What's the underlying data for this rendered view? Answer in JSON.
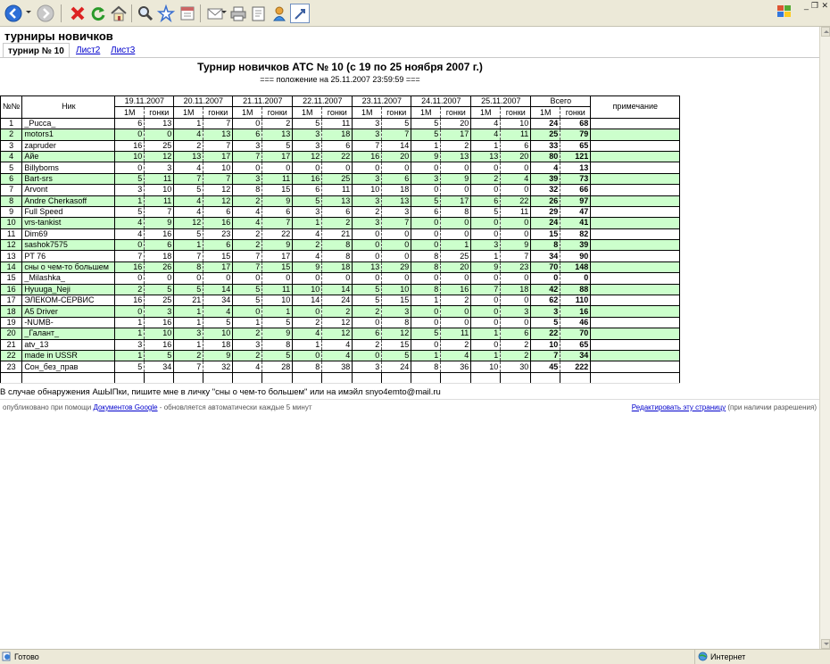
{
  "page": {
    "title": "турниры новичков"
  },
  "tabs": [
    {
      "label": "турнир № 10",
      "active": true
    },
    {
      "label": "Лист2",
      "active": false
    },
    {
      "label": "Лист3",
      "active": false
    }
  ],
  "sheet": {
    "title": "Турнир новичков АТС № 10 (с 19 по 25 ноября 2007 г.)",
    "subtitle": "=== положение на 25.11.2007 23:59:59 ===",
    "headers": {
      "num": "№№",
      "nick": "Ник",
      "dates": [
        "19.11.2007",
        "20.11.2007",
        "21.11.2007",
        "22.11.2007",
        "23.11.2007",
        "24.11.2007",
        "25.11.2007"
      ],
      "total": "Всего",
      "note": "примечание",
      "sub1": "1М",
      "sub2": "гонки"
    },
    "rows": [
      {
        "n": "1",
        "nick": "_Рucca_",
        "v": [
          6,
          13,
          1,
          7,
          0,
          2,
          5,
          11,
          3,
          5,
          5,
          20,
          4,
          10
        ],
        "t1": "24",
        "t2": "68"
      },
      {
        "n": "2",
        "nick": "motors1",
        "v": [
          0,
          0,
          4,
          13,
          6,
          13,
          3,
          18,
          3,
          7,
          5,
          17,
          4,
          11
        ],
        "t1": "25",
        "t2": "79"
      },
      {
        "n": "3",
        "nick": "zapruder",
        "v": [
          16,
          25,
          2,
          7,
          3,
          5,
          3,
          6,
          7,
          14,
          1,
          2,
          1,
          6
        ],
        "t1": "33",
        "t2": "65"
      },
      {
        "n": "4",
        "nick": "Айе",
        "v": [
          10,
          12,
          13,
          17,
          7,
          17,
          12,
          22,
          16,
          20,
          9,
          13,
          13,
          20
        ],
        "t1": "80",
        "t2": "121"
      },
      {
        "n": "5",
        "nick": "Billyboms",
        "v": [
          0,
          3,
          4,
          10,
          0,
          0,
          0,
          0,
          0,
          0,
          0,
          0,
          0,
          0
        ],
        "t1": "4",
        "t2": "13"
      },
      {
        "n": "6",
        "nick": "Bart-srs",
        "v": [
          5,
          11,
          7,
          7,
          3,
          11,
          16,
          25,
          3,
          6,
          3,
          9,
          2,
          4
        ],
        "t1": "39",
        "t2": "73"
      },
      {
        "n": "7",
        "nick": "Arvont",
        "v": [
          3,
          10,
          5,
          12,
          8,
          15,
          6,
          11,
          10,
          18,
          0,
          0,
          0,
          0
        ],
        "t1": "32",
        "t2": "66"
      },
      {
        "n": "8",
        "nick": "Andre Cherkasoff",
        "v": [
          1,
          11,
          4,
          12,
          2,
          9,
          5,
          13,
          3,
          13,
          5,
          17,
          6,
          22
        ],
        "t1": "26",
        "t2": "97"
      },
      {
        "n": "9",
        "nick": "Full Speed",
        "v": [
          5,
          7,
          4,
          6,
          4,
          6,
          3,
          6,
          2,
          3,
          6,
          8,
          5,
          11
        ],
        "t1": "29",
        "t2": "47"
      },
      {
        "n": "10",
        "nick": "vrs-tankist",
        "v": [
          4,
          9,
          12,
          16,
          4,
          7,
          1,
          2,
          3,
          7,
          0,
          0,
          0,
          0
        ],
        "t1": "24",
        "t2": "41"
      },
      {
        "n": "11",
        "nick": "Dim69",
        "v": [
          4,
          16,
          5,
          23,
          2,
          22,
          4,
          21,
          0,
          0,
          0,
          0,
          0,
          0
        ],
        "t1": "15",
        "t2": "82"
      },
      {
        "n": "12",
        "nick": "sashok7575",
        "v": [
          0,
          6,
          1,
          6,
          2,
          9,
          2,
          8,
          0,
          0,
          0,
          1,
          3,
          9
        ],
        "t1": "8",
        "t2": "39"
      },
      {
        "n": "13",
        "nick": "PT 76",
        "v": [
          7,
          18,
          7,
          15,
          7,
          17,
          4,
          8,
          0,
          0,
          8,
          25,
          1,
          7
        ],
        "t1": "34",
        "t2": "90"
      },
      {
        "n": "14",
        "nick": "сны о чем-то большем",
        "v": [
          16,
          26,
          8,
          17,
          7,
          15,
          9,
          18,
          13,
          29,
          8,
          20,
          9,
          23
        ],
        "t1": "70",
        "t2": "148"
      },
      {
        "n": "15",
        "nick": "_Milashka_",
        "v": [
          0,
          0,
          0,
          0,
          0,
          0,
          0,
          0,
          0,
          0,
          0,
          0,
          0,
          0
        ],
        "t1": "0",
        "t2": "0"
      },
      {
        "n": "16",
        "nick": "Hyuuga_Neji",
        "v": [
          2,
          5,
          5,
          14,
          5,
          11,
          10,
          14,
          5,
          10,
          8,
          16,
          7,
          18
        ],
        "t1": "42",
        "t2": "88"
      },
      {
        "n": "17",
        "nick": "ЭЛЕКОМ-СЕРВИС",
        "v": [
          16,
          25,
          21,
          34,
          5,
          10,
          14,
          24,
          5,
          15,
          1,
          2,
          0,
          0
        ],
        "t1": "62",
        "t2": "110"
      },
      {
        "n": "18",
        "nick": "A5 Driver",
        "v": [
          0,
          3,
          1,
          4,
          0,
          1,
          0,
          2,
          2,
          3,
          0,
          0,
          0,
          3
        ],
        "t1": "3",
        "t2": "16"
      },
      {
        "n": "19",
        "nick": "-NUMB-",
        "v": [
          1,
          16,
          1,
          5,
          1,
          5,
          2,
          12,
          0,
          8,
          0,
          0,
          0,
          0
        ],
        "t1": "5",
        "t2": "46"
      },
      {
        "n": "20",
        "nick": "_Галант_",
        "v": [
          1,
          10,
          3,
          10,
          2,
          9,
          4,
          12,
          6,
          12,
          5,
          11,
          1,
          6
        ],
        "t1": "22",
        "t2": "70"
      },
      {
        "n": "21",
        "nick": "atv_13",
        "v": [
          3,
          16,
          1,
          18,
          3,
          8,
          1,
          4,
          2,
          15,
          0,
          2,
          0,
          2
        ],
        "t1": "10",
        "t2": "65"
      },
      {
        "n": "22",
        "nick": "made in USSR",
        "v": [
          1,
          5,
          2,
          9,
          2,
          5,
          0,
          4,
          0,
          5,
          1,
          4,
          1,
          2
        ],
        "t1": "7",
        "t2": "34"
      },
      {
        "n": "23",
        "nick": "Сон_без_прав",
        "v": [
          5,
          34,
          7,
          32,
          4,
          28,
          8,
          38,
          3,
          24,
          8,
          36,
          10,
          30
        ],
        "t1": "45",
        "t2": "222"
      }
    ],
    "footer_note": "В случае обнаружения АшЫПки, пишите мне в личку \"сны о чем-то большем\" или на имэйл snyo4emto@mail.ru"
  },
  "publish": {
    "prefix": "опубликовано при помощи ",
    "link": "Документов Google",
    "suffix": " - обновляется автоматически каждые 5 минут",
    "edit_link": "Редактировать эту страницу",
    "edit_suffix": " (при наличии разрешения)"
  },
  "status": {
    "left": "Готово",
    "zone": "Интернет"
  },
  "colors": {
    "green_row": "#ccffcc",
    "link": "#0000cc"
  }
}
